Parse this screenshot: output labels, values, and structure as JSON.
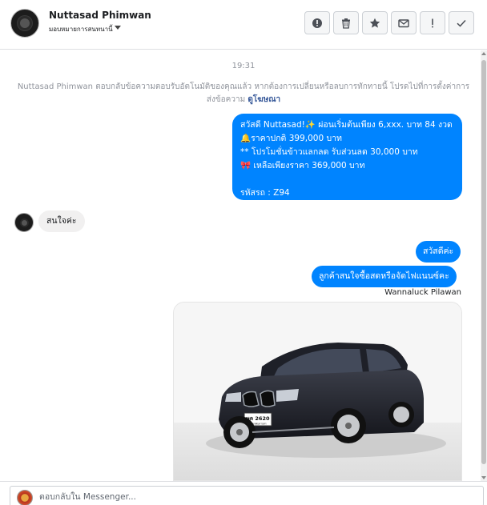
{
  "header": {
    "contact_name": "Nuttasad Phimwan",
    "subtitle": "มอบหมายการสนทนานี้",
    "tools": [
      {
        "icon": "alert-circle-icon",
        "label": "!"
      },
      {
        "icon": "trash-icon",
        "label": ""
      },
      {
        "icon": "star-icon",
        "label": ""
      },
      {
        "icon": "mail-icon",
        "label": ""
      },
      {
        "icon": "exclamation-icon",
        "label": "!"
      },
      {
        "icon": "checkmark-icon",
        "label": ""
      }
    ]
  },
  "conversation": {
    "timestamp": "19:31",
    "system_message": "Nuttasad Phimwan ตอบกลับข้อความตอบรับอัตโนมัติของคุณแล้ว หากต้องการเปลี่ยนหรือลบการทักทายนี้ โปรดไปที่การตั้งค่าการส่งข้อความ",
    "system_link": "ดูโฆษณา",
    "promo_lines": [
      "สวัสดี Nuttasad!✨ ผ่อนเริ่มต้นเพียง 6,xxx. บาท 84 งวด",
      "🔔ราคาปกติ 399,000 บาท",
      "** โปรโมชั่นข้าวแลกลด รับส่วนลด 30,000 บาท",
      "🎀 เหลือเพียงราคา 369,000 บาท"
    ],
    "promo_code": "รหัสรถ : Z94",
    "incoming_reply": "สนใจค่ะ",
    "outgoing_reply_1": "สวัสดีค่ะ",
    "outgoing_reply_2": "ลูกค้าสนใจซื้อสดหรือจัดไฟแนนซ์คะ",
    "sender_name": "Wannaluck Pilawan",
    "photo": {
      "plate_line_1": "ษค 2620",
      "plate_line_2": "กรุงเทพมหานคร"
    }
  },
  "composer": {
    "placeholder": "ตอบกลับใน Messenger..."
  },
  "colors": {
    "outgoing_bubble": "#0084ff",
    "incoming_bubble": "#f1f0f0",
    "muted_text": "#90949c",
    "link": "#365899"
  }
}
